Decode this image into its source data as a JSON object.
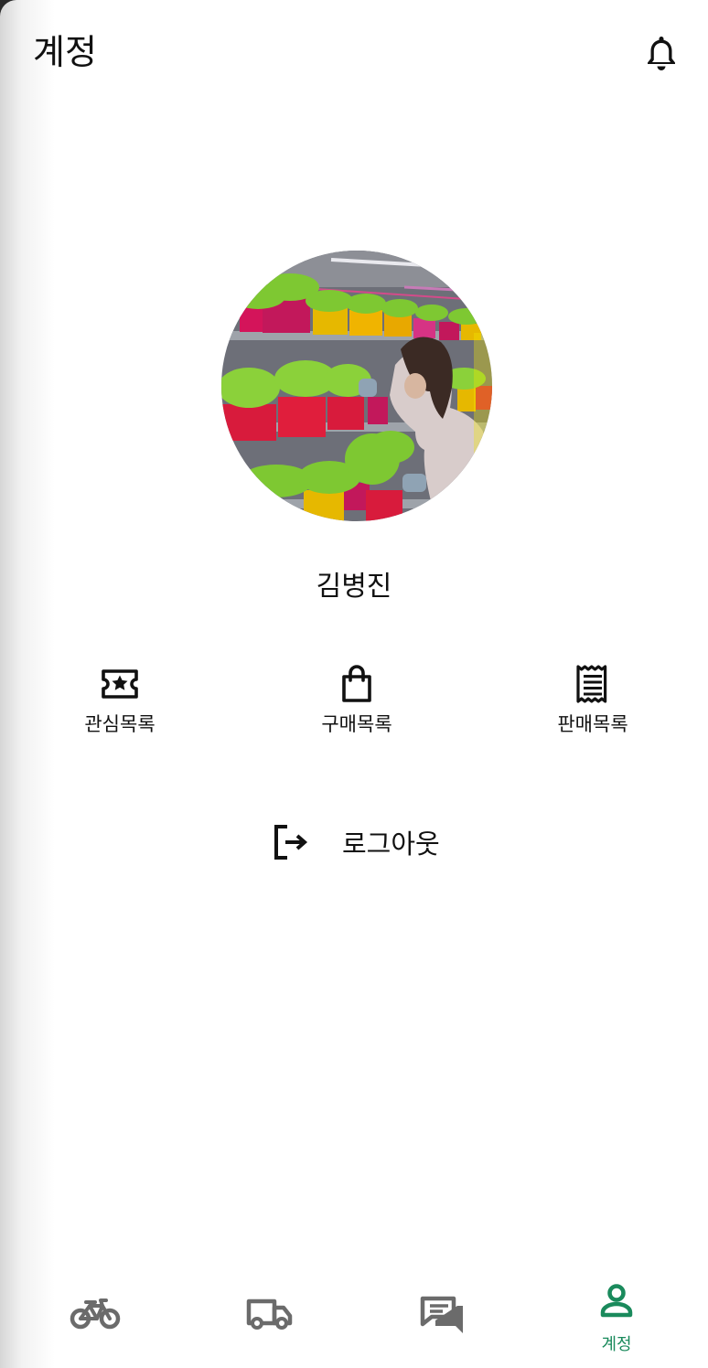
{
  "header": {
    "title": "계정",
    "notification_icon": "bell-icon"
  },
  "profile": {
    "name": "김병진",
    "avatar": "profile-photo"
  },
  "menu": [
    {
      "label": "관심목록",
      "icon": "ticket-star-icon"
    },
    {
      "label": "구매목록",
      "icon": "shopping-bag-icon"
    },
    {
      "label": "판매목록",
      "icon": "receipt-icon"
    }
  ],
  "logout": {
    "label": "로그아웃",
    "icon": "logout-icon"
  },
  "bottom_nav": {
    "items": [
      {
        "icon": "bicycle-icon",
        "label": ""
      },
      {
        "icon": "truck-icon",
        "label": ""
      },
      {
        "icon": "chat-icon",
        "label": ""
      },
      {
        "icon": "person-icon",
        "label": "계정",
        "active": true
      }
    ],
    "active_color": "#1a8a5c",
    "inactive_color": "#6b6b6b"
  }
}
